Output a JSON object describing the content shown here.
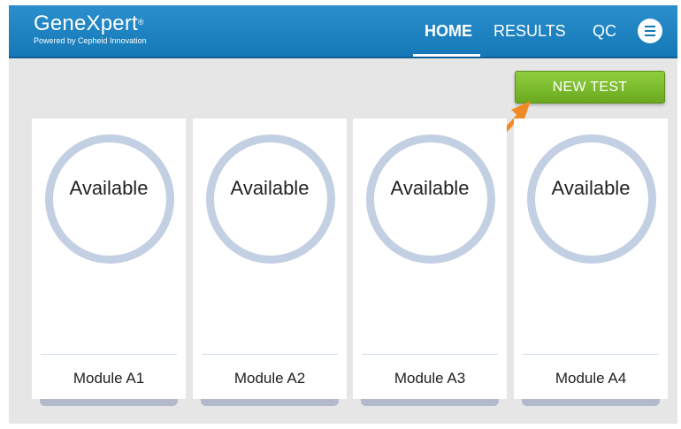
{
  "header": {
    "brand_name": "GeneXpert",
    "brand_reg_mark": "®",
    "brand_tagline": "Powered by Cepheid Innovation",
    "nav": {
      "home": "HOME",
      "results": "RESULTS",
      "qc": "QC"
    },
    "active_tab": "HOME",
    "menu_icon": "menu-icon",
    "color": "#1f84c3"
  },
  "actions": {
    "new_test_label": "NEW TEST",
    "new_test_color": "#7cbd2e",
    "pointer_arrow_color": "#f08a24"
  },
  "modules": [
    {
      "status": "Available",
      "name": "Module A1"
    },
    {
      "status": "Available",
      "name": "Module A2"
    },
    {
      "status": "Available",
      "name": "Module A3"
    },
    {
      "status": "Available",
      "name": "Module A4"
    }
  ],
  "colors": {
    "background": "#e6e6e6",
    "status_ring": "#c3cfe2"
  }
}
